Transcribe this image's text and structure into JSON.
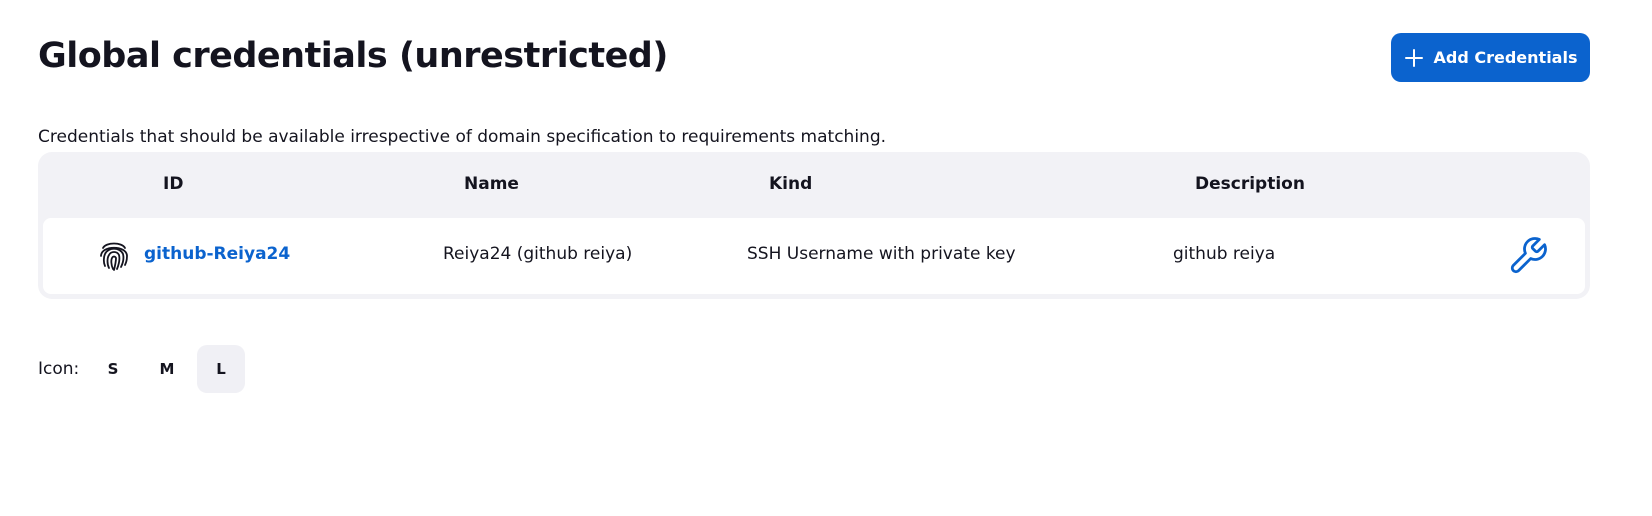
{
  "page": {
    "title": "Global credentials (unrestricted)",
    "description": "Credentials that should be available irrespective of domain specification to requirements matching."
  },
  "toolbar": {
    "add_label": "Add Credentials",
    "add_icon": "plus-icon"
  },
  "table": {
    "columns": [
      "ID",
      "Name",
      "Kind",
      "Description"
    ],
    "rows": [
      {
        "icon": "fingerprint-icon",
        "id": "github-Reiya24",
        "name": "Reiya24 (github reiya)",
        "kind": "SSH Username with private key",
        "description": "github reiya",
        "action_icon": "wrench-icon"
      }
    ]
  },
  "icon_size": {
    "label": "Icon:",
    "options": [
      "S",
      "M",
      "L"
    ],
    "selected": "L"
  },
  "colors": {
    "accent": "#0b63ce",
    "table_bg": "#f2f2f6",
    "text": "#14141f"
  }
}
